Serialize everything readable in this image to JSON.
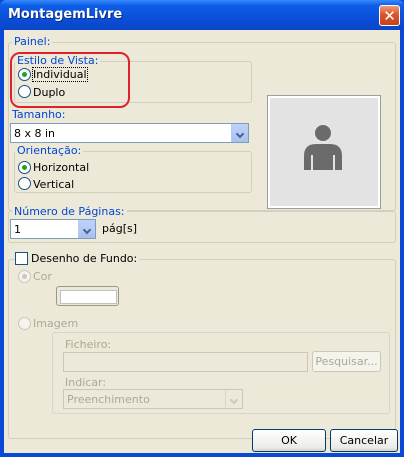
{
  "window": {
    "title": "MontagemLivre"
  },
  "panel": {
    "legend": "Painel:",
    "view_style": {
      "legend": "Estilo de Vista:",
      "options": [
        {
          "label": "Individual",
          "checked": true
        },
        {
          "label": "Duplo",
          "checked": false
        }
      ]
    },
    "size": {
      "label": "Tamanho:",
      "value": "8 x 8 in"
    },
    "orientation": {
      "legend": "Orientação:",
      "options": [
        {
          "label": "Horizontal",
          "checked": true
        },
        {
          "label": "Vertical",
          "checked": false
        }
      ]
    },
    "preview_icon": "person-silhouette-icon"
  },
  "pages": {
    "legend": "Número de Páginas:",
    "value": "1",
    "unit": "pág[s]"
  },
  "background": {
    "label": "Desenho de Fundo:",
    "checked": false,
    "color_option": {
      "label": "Cor",
      "checked": true
    },
    "image_option": {
      "label": "Imagem",
      "checked": false
    },
    "file_label": "Ficheiro:",
    "file_value": "",
    "browse_label": "Pesquisar...",
    "indicate_label": "Indicar:",
    "indicate_value": "Preenchimento"
  },
  "footer": {
    "ok_label": "OK",
    "cancel_label": "Cancelar"
  },
  "colors": {
    "accent_highlight": "#e0222f",
    "titlebar": "#0a4fd8",
    "label_blue": "#0046d5"
  }
}
